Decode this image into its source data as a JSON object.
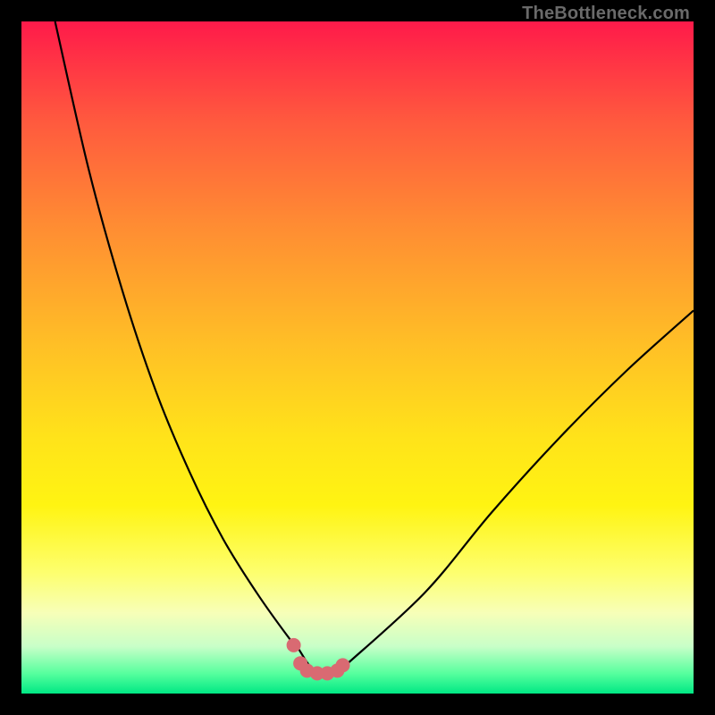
{
  "watermark": "TheBottleneck.com",
  "colors": {
    "frame_border": "#000000",
    "curve_stroke": "#000000",
    "marker_fill": "#d96a72",
    "marker_stroke": "#d96a72"
  },
  "chart_data": {
    "type": "line",
    "title": "",
    "xlabel": "",
    "ylabel": "",
    "xlim": [
      0,
      100
    ],
    "ylim": [
      0,
      100
    ],
    "grid": false,
    "series": [
      {
        "name": "bottleneck-curve",
        "x": [
          5,
          10,
          15,
          20,
          25,
          30,
          35,
          40,
          41,
          43,
          45,
          47,
          48,
          60,
          70,
          80,
          90,
          100
        ],
        "y": [
          100,
          78,
          60,
          45,
          33,
          23,
          15,
          8,
          7,
          4,
          3,
          3,
          4,
          15,
          27,
          38,
          48,
          57
        ]
      }
    ],
    "markers": {
      "name": "bottom-dots",
      "x": [
        40.5,
        41.5,
        42.5,
        44.0,
        45.5,
        47.0,
        47.8
      ],
      "y": [
        7.2,
        4.5,
        3.4,
        3.0,
        3.0,
        3.4,
        4.2
      ]
    }
  }
}
